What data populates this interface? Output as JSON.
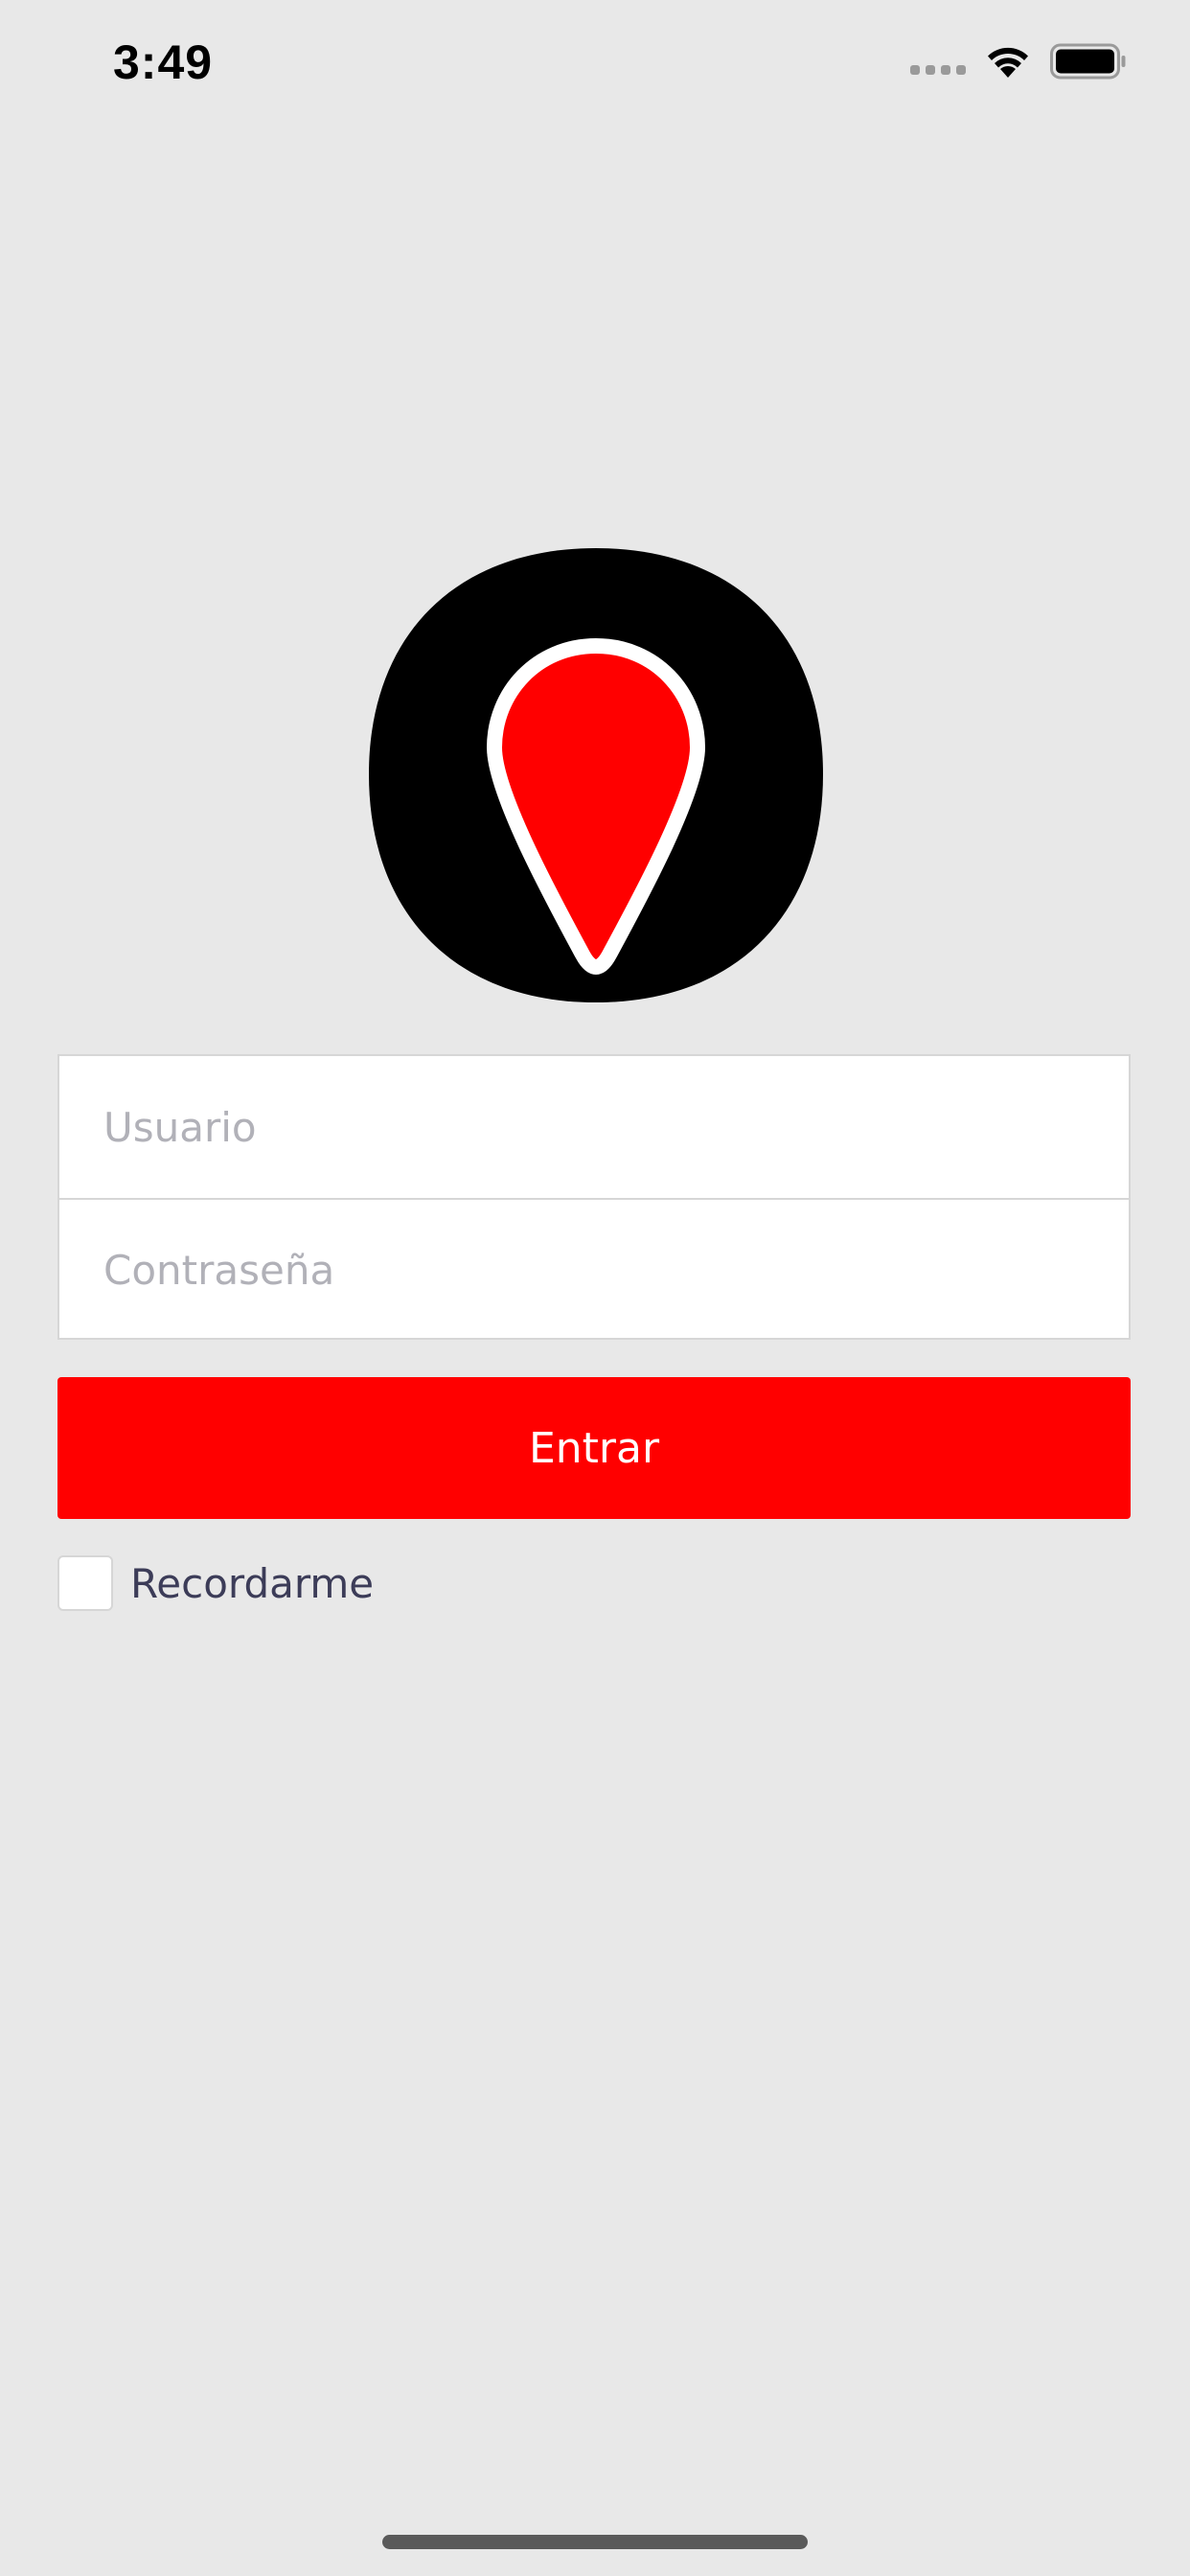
{
  "status_bar": {
    "time": "3:49",
    "signal_icon": "signal-dots-icon",
    "wifi_icon": "wifi-icon",
    "battery_icon": "battery-icon"
  },
  "logo": {
    "icon": "map-pin-icon",
    "colors": {
      "background": "#000000",
      "pin": "#ff0000",
      "pin_outline": "#ffffff"
    }
  },
  "form": {
    "username": {
      "value": "",
      "placeholder": "Usuario"
    },
    "password": {
      "value": "",
      "placeholder": "Contraseña"
    }
  },
  "login_button": {
    "label": "Entrar",
    "color": "#ff0000"
  },
  "remember_me": {
    "label": "Recordarme",
    "checked": false
  },
  "colors": {
    "page_background": "#e8e8e8",
    "accent": "#ff0000",
    "label_text": "#3c3c58",
    "placeholder_text": "#b1b1b8"
  }
}
